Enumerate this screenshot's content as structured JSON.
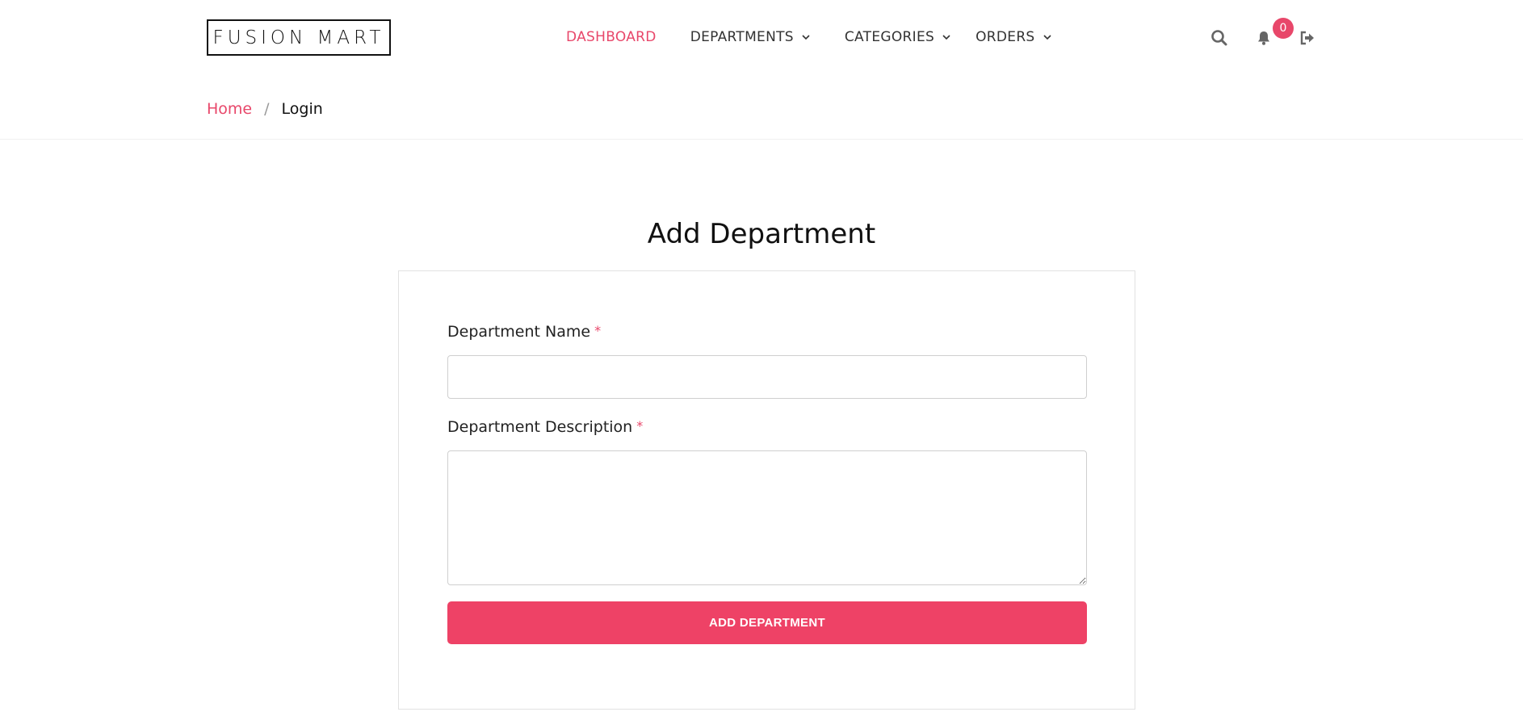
{
  "header": {
    "logo": "FUSION MART",
    "nav": [
      {
        "label": "DASHBOARD",
        "active": true
      },
      {
        "label": "DEPARTMENTS",
        "dropdown": true
      },
      {
        "label": "CATEGORIES",
        "dropdown": true
      },
      {
        "label": "ORDERS",
        "dropdown": true
      }
    ],
    "icons": [
      "search-icon",
      "bell-icon",
      "sign-out-icon"
    ],
    "notification_count": "0"
  },
  "breadcrumb": {
    "home": "Home",
    "separator": "/",
    "current": "Login"
  },
  "form": {
    "title": "Add Department",
    "name_label": "Department Name",
    "name_required": "*",
    "name_value": "",
    "description_label": "Department Description",
    "description_required": "*",
    "description_value": "",
    "submit_label": "ADD DEPARTMENT"
  },
  "colors": {
    "accent": "#ee4266",
    "text": "#222222",
    "border": "#cfcfcf"
  }
}
